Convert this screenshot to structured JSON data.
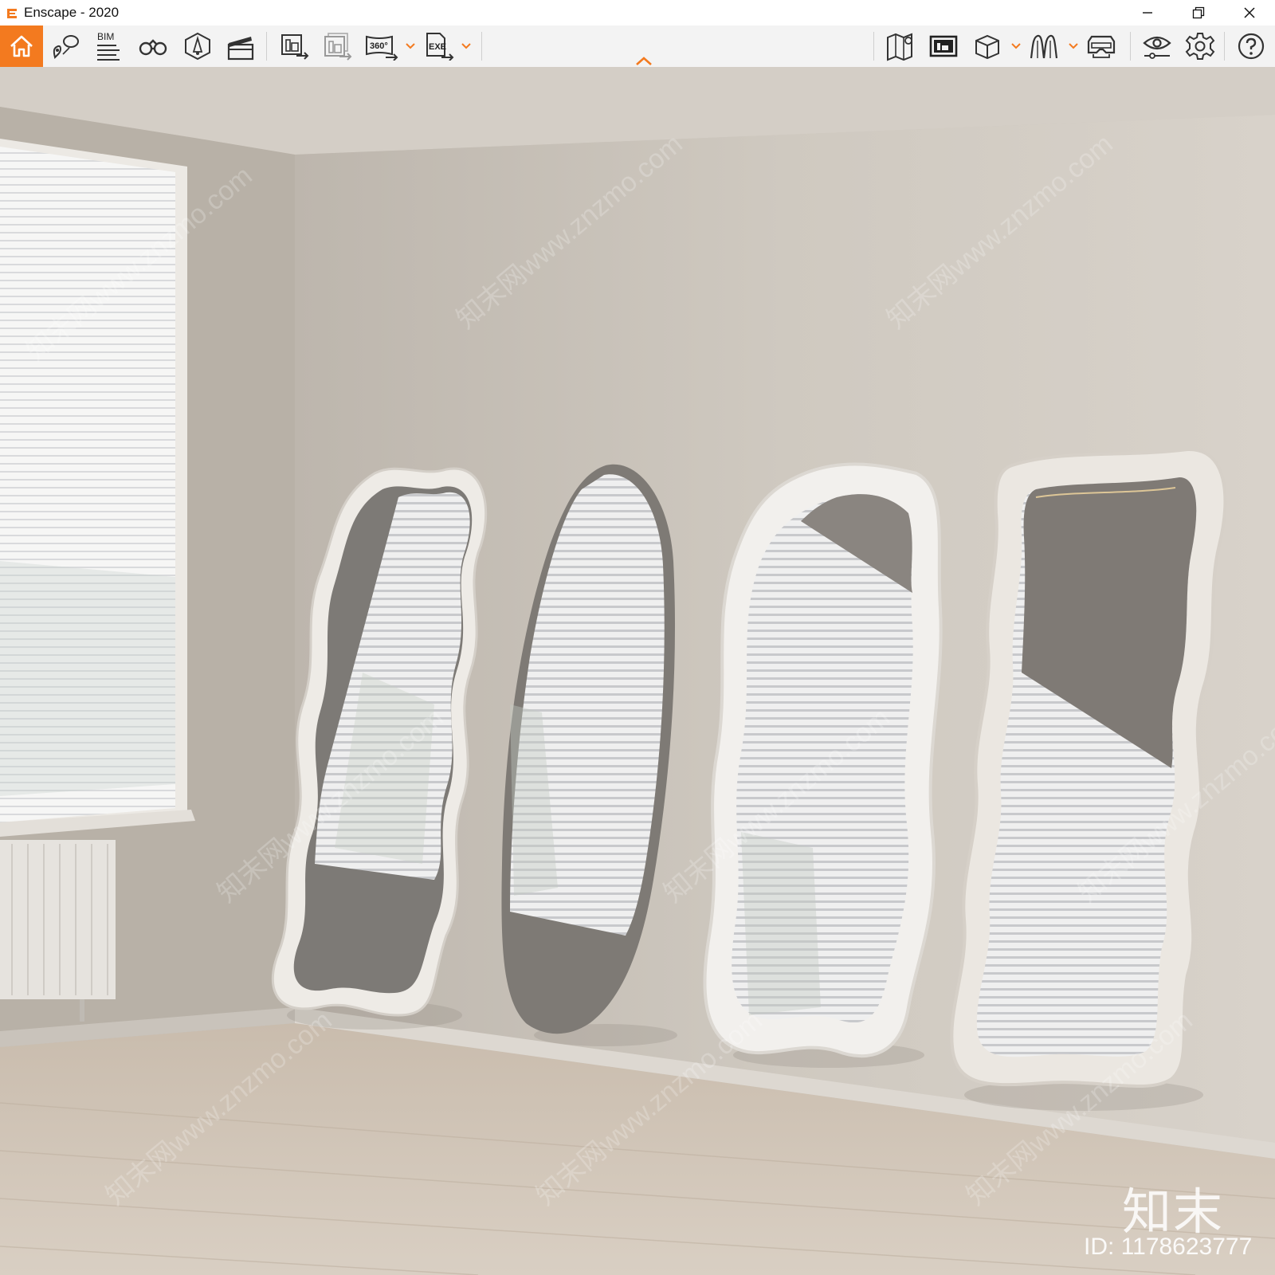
{
  "window": {
    "title": "Enscape - 2020",
    "controls": [
      "minimize",
      "restore",
      "close"
    ]
  },
  "toolbar": {
    "accent_color": "#f37a1f",
    "bim_label": "BIM",
    "vr360_label": "360°",
    "exe_label": "EXE",
    "left_tools": [
      "home-icon",
      "views-icon",
      "bim-icon",
      "binoculars-icon",
      "asset-library-icon",
      "video-editor-icon",
      "render-screenshot-icon",
      "batch-render-icon",
      "export-360-icon",
      "export-exe-icon"
    ],
    "right_tools": [
      "map-icon",
      "gallery-icon",
      "cube-icon",
      "walk-mode-icon",
      "vr-headset-icon",
      "visual-settings-icon",
      "settings-icon",
      "help-icon"
    ]
  },
  "viewport": {
    "scene": "rendered room with four floor mirrors",
    "watermark_text": "知末网www.znzmo.com",
    "brand_watermark": "知末",
    "image_id": "ID: 1178623777"
  }
}
